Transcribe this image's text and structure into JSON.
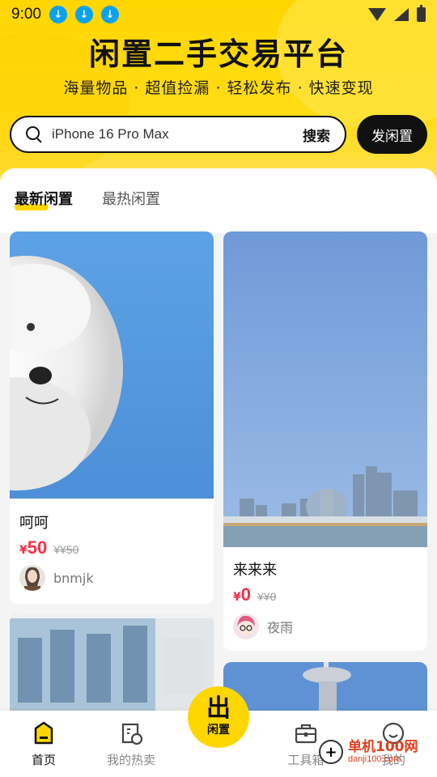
{
  "status_bar": {
    "time": "9:00",
    "download_icons": [
      "download-icon",
      "download-icon",
      "download-icon"
    ]
  },
  "header": {
    "title": "闲置二手交易平台",
    "subtitle": "海量物品 · 超值捡漏 · 轻松发布 · 快速变现"
  },
  "search": {
    "value": "iPhone 16 Pro Max",
    "button_label": "搜索"
  },
  "publish_button_label": "发闲置",
  "tabs": [
    {
      "label": "最新闲置",
      "active": true
    },
    {
      "label": "最热闲置",
      "active": false
    }
  ],
  "items": [
    {
      "title": "呵呵",
      "price_symbol": "¥",
      "price": "50",
      "original_price": "¥¥50",
      "seller": "bnmjk"
    },
    {
      "title": "来来来",
      "price_symbol": "¥",
      "price": "0",
      "original_price": "¥¥0",
      "seller": "夜雨"
    }
  ],
  "bottom_nav": [
    {
      "label": "首页",
      "icon": "home-icon",
      "active": true
    },
    {
      "label": "我的热卖",
      "icon": "hot-sale-icon",
      "active": false
    },
    {
      "label": "工具箱",
      "icon": "toolbox-icon",
      "active": false
    },
    {
      "label": "我的",
      "icon": "profile-icon",
      "active": false
    }
  ],
  "center_fab": {
    "big": "出",
    "small": "闲置"
  },
  "watermark": {
    "main": "单机100网",
    "sub": "danji100.com"
  },
  "colors": {
    "accent": "#ffd600",
    "price": "#f5304a",
    "dark": "#111111"
  }
}
